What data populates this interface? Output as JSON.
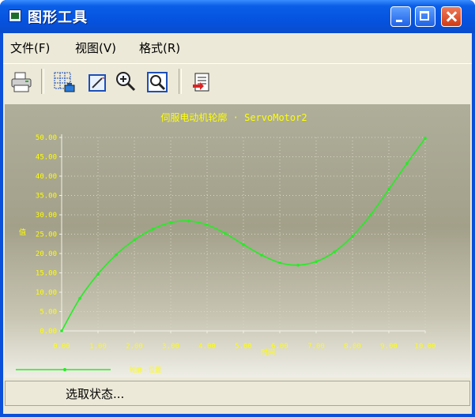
{
  "window": {
    "title": "图形工具"
  },
  "menu": [
    {
      "label": "文件(F)"
    },
    {
      "label": "视图(V)"
    },
    {
      "label": "格式(R)"
    }
  ],
  "toolbar": {
    "tools": [
      "printer-icon",
      "grid-select-icon",
      "edit-icon",
      "zoom-in-icon",
      "zoom-fit-icon",
      "export-icon"
    ]
  },
  "chart_data": {
    "type": "line",
    "title": "伺服电动机轮廓 · ServoMotor2",
    "ylim": [
      0,
      50
    ],
    "xlim": [
      0,
      10
    ],
    "yticks": [
      "0.00",
      "5.00",
      "10.00",
      "15.00",
      "20.00",
      "25.00",
      "30.00",
      "35.00",
      "40.00",
      "45.00",
      "50.00"
    ],
    "xticks": [
      "0.00",
      "1.00",
      "2.00",
      "3.00",
      "4.00",
      "5.00",
      "6.00",
      "7.00",
      "8.00",
      "9.00",
      "10.00"
    ],
    "xlabel": "时间",
    "ylabel": "值",
    "grid": true,
    "legend_position": "bottom-left",
    "series": [
      {
        "name": "轮廓 - 位置",
        "color": "#22ee22",
        "x": [
          0,
          0.5,
          1,
          1.5,
          2,
          2.5,
          3,
          3.5,
          4,
          4.5,
          5,
          5.5,
          6,
          6.5,
          7,
          7.5,
          8,
          8.5,
          9,
          9.5,
          10
        ],
        "y": [
          0,
          8.4,
          14.7,
          19.7,
          23.5,
          26.3,
          28.0,
          28.4,
          27.4,
          25.2,
          22.3,
          19.6,
          17.6,
          17.0,
          17.9,
          20.4,
          24.5,
          30.0,
          36.6,
          43.3,
          49.8
        ]
      }
    ]
  },
  "status": {
    "text": "选取状态..."
  },
  "colors": {
    "title_bar": "#0553e0",
    "chart_bg": "#a3a08a",
    "series": "#22ee22",
    "tick_labels": "#ffff00"
  }
}
